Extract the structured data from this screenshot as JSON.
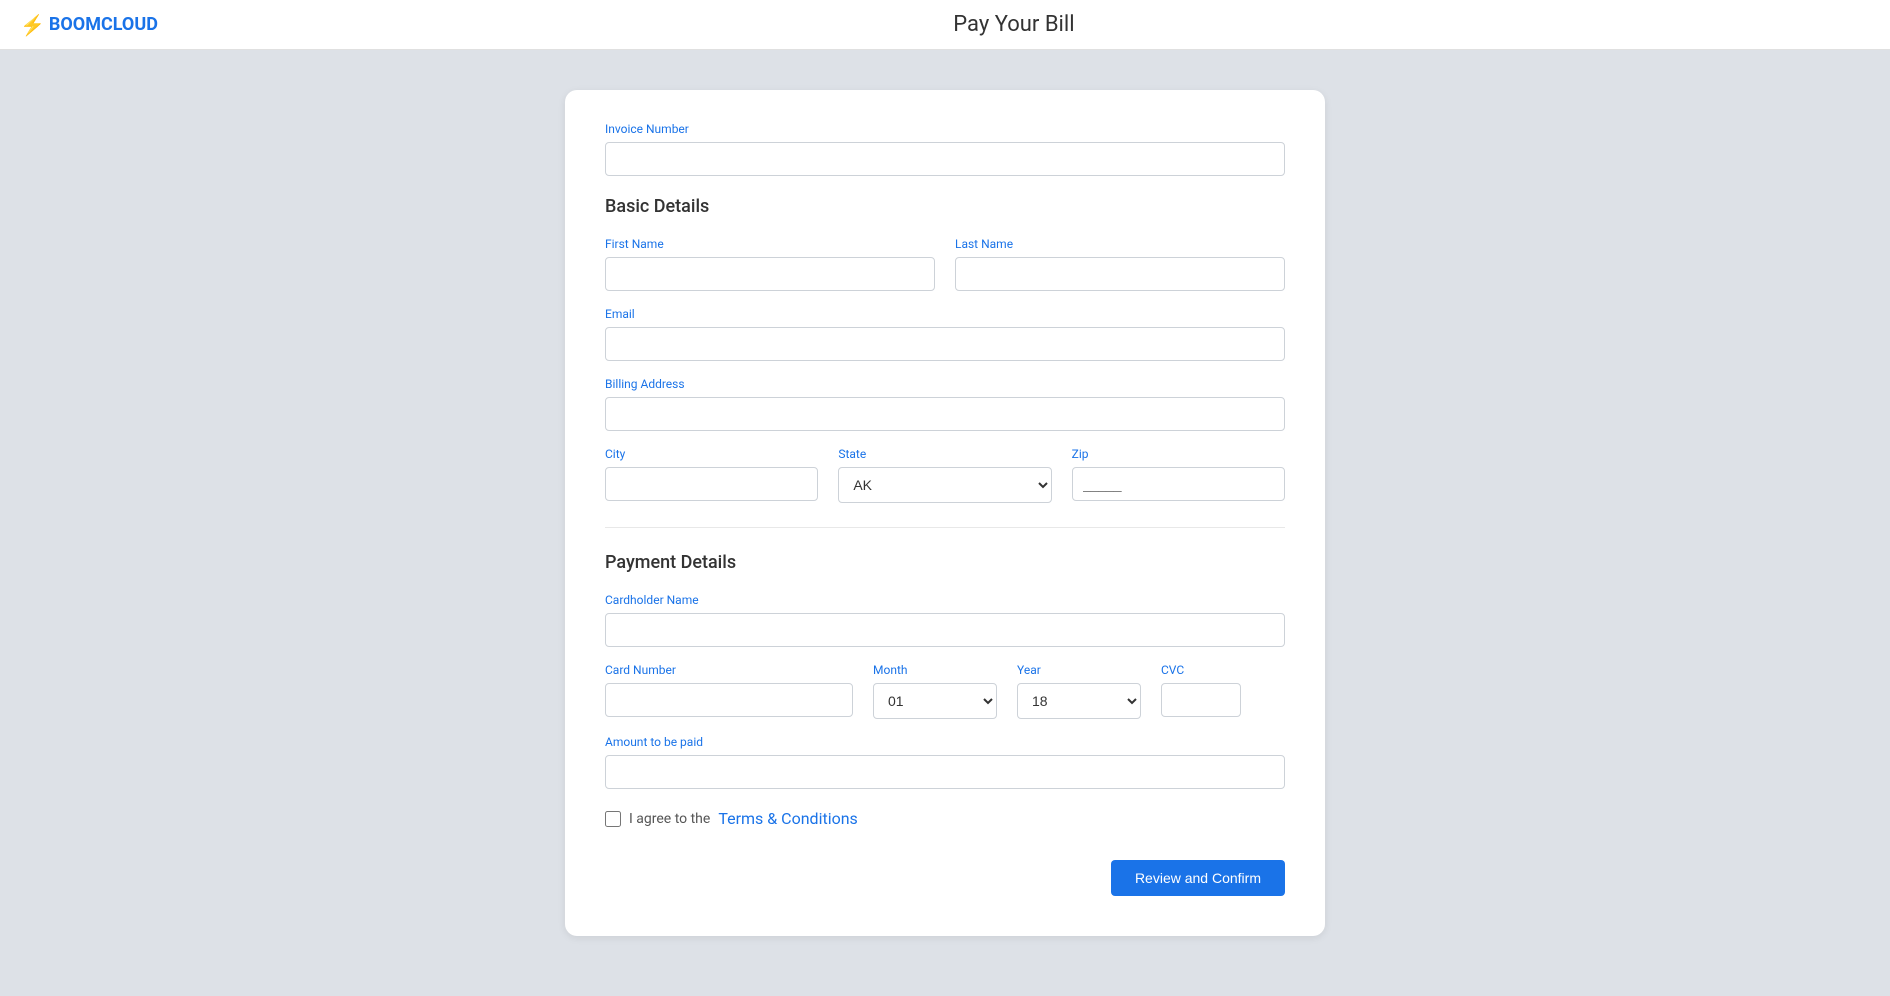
{
  "logo": {
    "bolt": "⚡",
    "text": "BOOMCLOUD"
  },
  "page": {
    "title": "Pay Your Bill"
  },
  "form": {
    "invoice_number_label": "Invoice Number",
    "invoice_number_placeholder": "",
    "basic_details_title": "Basic Details",
    "first_name_label": "First Name",
    "last_name_label": "Last Name",
    "email_label": "Email",
    "billing_address_label": "Billing Address",
    "city_label": "City",
    "state_label": "State",
    "state_default": "AK",
    "zip_label": "Zip",
    "zip_placeholder": "_____",
    "payment_details_title": "Payment Details",
    "cardholder_name_label": "Cardholder Name",
    "card_number_label": "Card Number",
    "month_label": "Month",
    "month_default": "01",
    "year_label": "Year",
    "year_default": "18",
    "cvc_label": "CVC",
    "amount_label": "Amount to be paid",
    "terms_text": "I agree to the ",
    "terms_link": "Terms & Conditions",
    "review_button": "Review and Confirm"
  }
}
